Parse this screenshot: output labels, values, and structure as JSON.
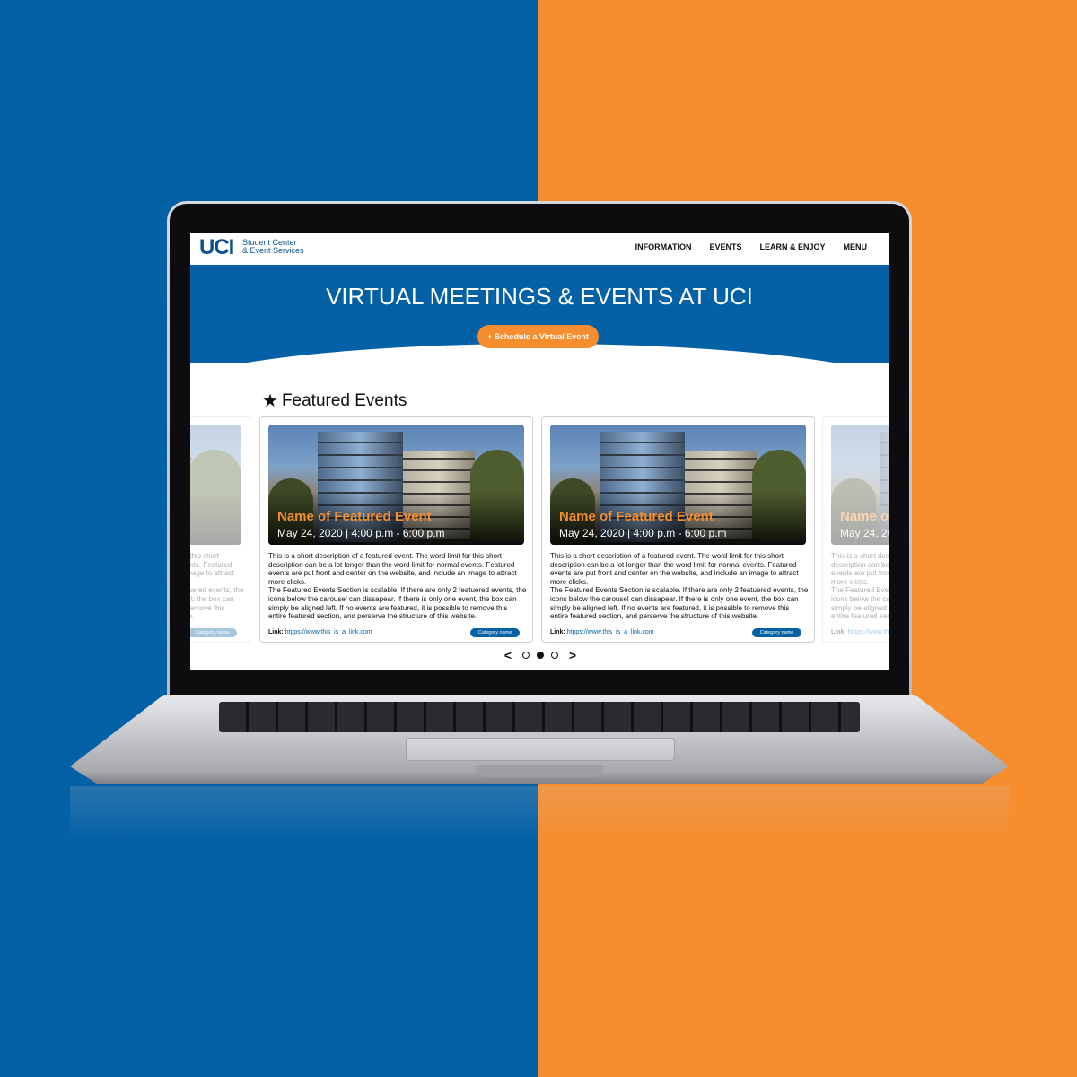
{
  "nav": {
    "logo_mark": "UCI",
    "logo_line1": "Student Center",
    "logo_line2": "& Event Services",
    "links": [
      "INFORMATION",
      "EVENTS",
      "LEARN & ENJOY",
      "MENU"
    ]
  },
  "hero": {
    "title": "VIRTUAL MEETINGS & EVENTS AT UCI",
    "button": "+ Schedule a Virtual Event"
  },
  "featured": {
    "heading": "Featured Events",
    "cards": [
      {
        "name": "Name of Featured Event",
        "date": "May 24, 2020 | 4:00 p.m - 6:00 p.m",
        "description": "This is a short description of a featured event. The word limit for this short description can be a lot longer than the word limit for normal events. Featured events are put front and center on the website, and include an image to attract more clicks.\nThe Featured Events Section is scalable. If there are only 2 featuered events, the icons below the carousel can dissapear. If there is only one event, the box can simply be aligned left. If no events are featured, it is possible to remove this entire featured section, and perserve the structure of this website.",
        "link_label": "Link:",
        "link_url": "htpps://www.this_is_a_link.com",
        "category": "Category name"
      },
      {
        "name": "Name of Featured Event",
        "date": "May 24, 2020 | 4:00 p.m - 6:00 p.m",
        "description": "This is a short description of a featured event. The word limit for this short description can be a lot longer than the word limit for normal events. Featured events are put front and center on the website, and include an image to attract more clicks.\nThe Featured Events Section is scalable. If there are only 2 featuered events, the icons below the carousel can dissapear. If there is only one event, the box can simply be aligned left. If no events are featured, it is possible to remove this entire featured section, and perserve the structure of this website.",
        "link_label": "Link:",
        "link_url": "htpps://www.this_is_a_link.com",
        "category": "Category name"
      }
    ],
    "carousel": {
      "prev": "<",
      "next": ">",
      "dots": 3,
      "active_dot": 2
    }
  },
  "colors": {
    "uci_blue": "#0561a6",
    "uci_orange": "#f68d2e"
  }
}
